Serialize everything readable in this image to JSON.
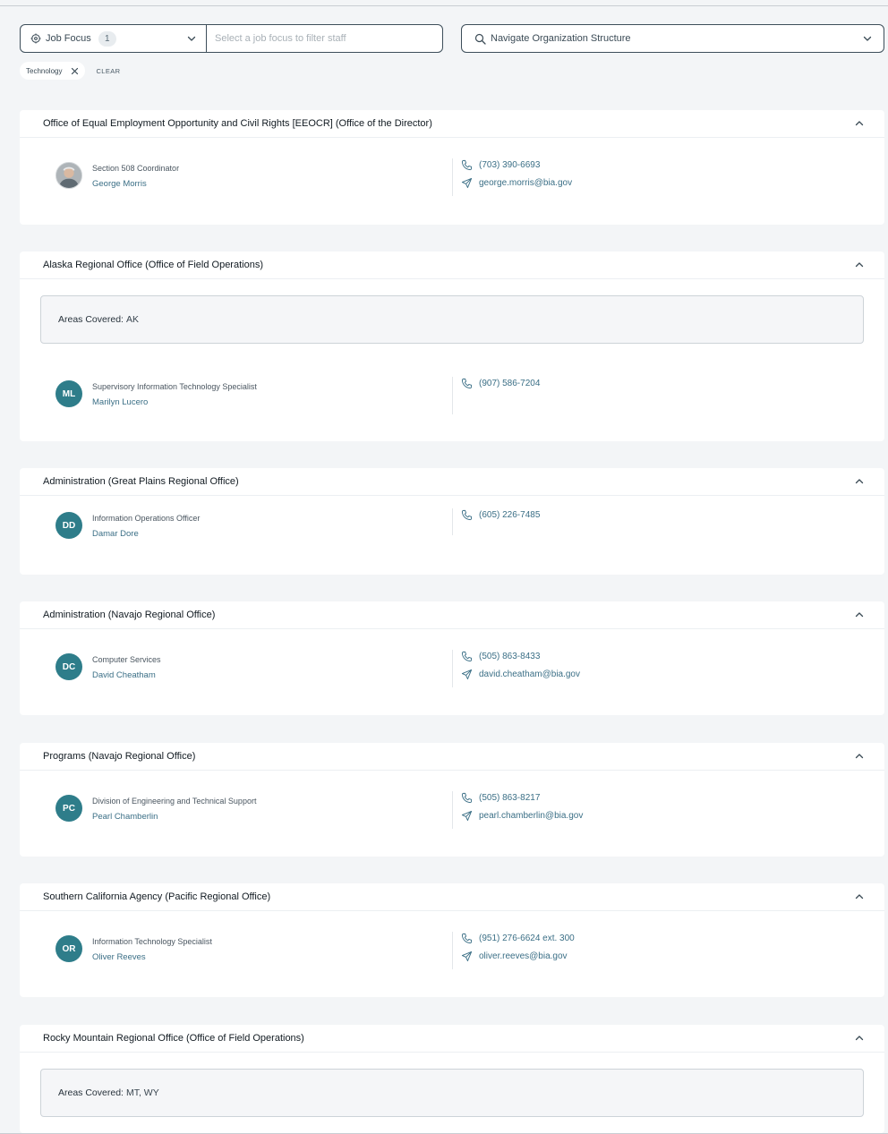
{
  "filters": {
    "job_focus_label": "Job Focus",
    "job_focus_count": "1",
    "job_focus_placeholder": "Select a job focus to filter staff",
    "org_nav_label": "Navigate Organization Structure",
    "chips": [
      "Technology"
    ],
    "clear_label": "CLEAR"
  },
  "offices": [
    {
      "title": "Office of Equal Employment Opportunity and Civil Rights [EEOCR] (Office of the Director)",
      "staff": {
        "avatar": "",
        "title": "Section 508 Coordinator",
        "name": "George Morris",
        "phone": "(703) 390-6693",
        "email": "george.morris@bia.gov"
      }
    },
    {
      "title": "Alaska Regional Office (Office of Field Operations)",
      "areas_label": "Areas Covered:",
      "areas_value": "AK",
      "staff": {
        "avatar": "ML",
        "title": "Supervisory Information Technology Specialist",
        "name": "Marilyn Lucero",
        "phone": "(907) 586-7204"
      }
    },
    {
      "title": "Administration (Great Plains Regional Office)",
      "staff": {
        "avatar": "DD",
        "title": "Information Operations Officer",
        "name": "Damar Dore",
        "phone": "(605) 226-7485"
      }
    },
    {
      "title": "Administration (Navajo Regional Office)",
      "staff": {
        "avatar": "DC",
        "title": "Computer Services",
        "name": "David Cheatham",
        "phone": "(505) 863-8433",
        "email": "david.cheatham@bia.gov"
      }
    },
    {
      "title": "Programs (Navajo Regional Office)",
      "staff": {
        "avatar": "PC",
        "title": "Division of Engineering and Technical Support",
        "name": "Pearl Chamberlin",
        "phone": "(505) 863-8217",
        "email": "pearl.chamberlin@bia.gov"
      }
    },
    {
      "title": "Southern California Agency (Pacific Regional Office)",
      "staff": {
        "avatar": "OR",
        "title": "Information Technology Specialist",
        "name": "Oliver Reeves",
        "phone": "(951) 276-6624 ext. 300",
        "email": "oliver.reeves@bia.gov"
      }
    },
    {
      "title": "Rocky Mountain Regional Office (Office of Field Operations)",
      "areas_label": "Areas Covered:",
      "areas_value": "MT, WY"
    }
  ],
  "colors": {
    "accent": "#2e7d8a",
    "link": "#3b6f86",
    "border": "#3d4e5a",
    "background": "#f3f5f7"
  }
}
